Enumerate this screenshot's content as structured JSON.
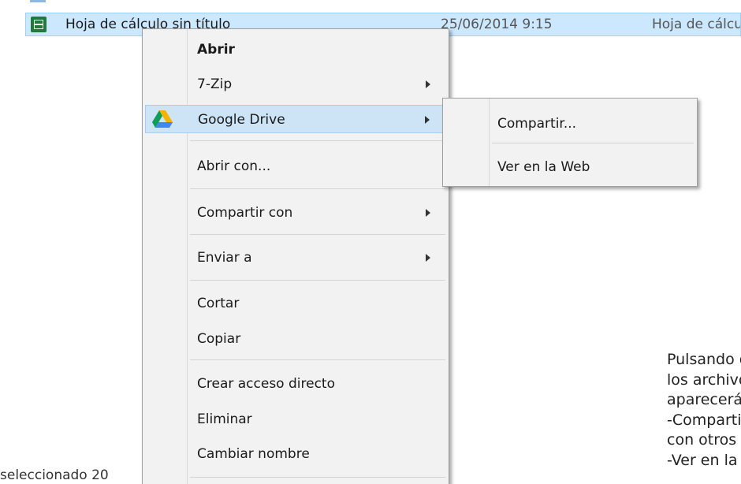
{
  "file_row": {
    "name": "Hoja de cálculo sin título",
    "date": "25/06/2014 9:15",
    "type": "Hoja de cálculo de Google"
  },
  "status_bar": {
    "text": "seleccionado  20"
  },
  "context_menu": {
    "items": [
      {
        "label": "Abrir"
      },
      {
        "label": "7-Zip"
      },
      {
        "label": "Google Drive"
      },
      {
        "label": "Abrir con..."
      },
      {
        "label": "Compartir con"
      },
      {
        "label": "Enviar a"
      },
      {
        "label": "Cortar"
      },
      {
        "label": "Copiar"
      },
      {
        "label": "Crear acceso directo"
      },
      {
        "label": "Eliminar"
      },
      {
        "label": "Cambiar nombre"
      }
    ]
  },
  "submenu": {
    "items": [
      {
        "label": "Compartir..."
      },
      {
        "label": "Ver en la Web"
      }
    ]
  },
  "explanation": {
    "lines": [
      "Pulsando con el botón de",
      "los archivos de la carpeta",
      "aparecerán dos nuevas o",
      "-Compartir: para compar",
      "con otros usuarios.",
      "-Ver en la web: para acc"
    ]
  },
  "colors": {
    "selection_bg": "#cce8ff",
    "menu_bg": "#f2f2f2",
    "hover_bg": "#cde4f7"
  }
}
